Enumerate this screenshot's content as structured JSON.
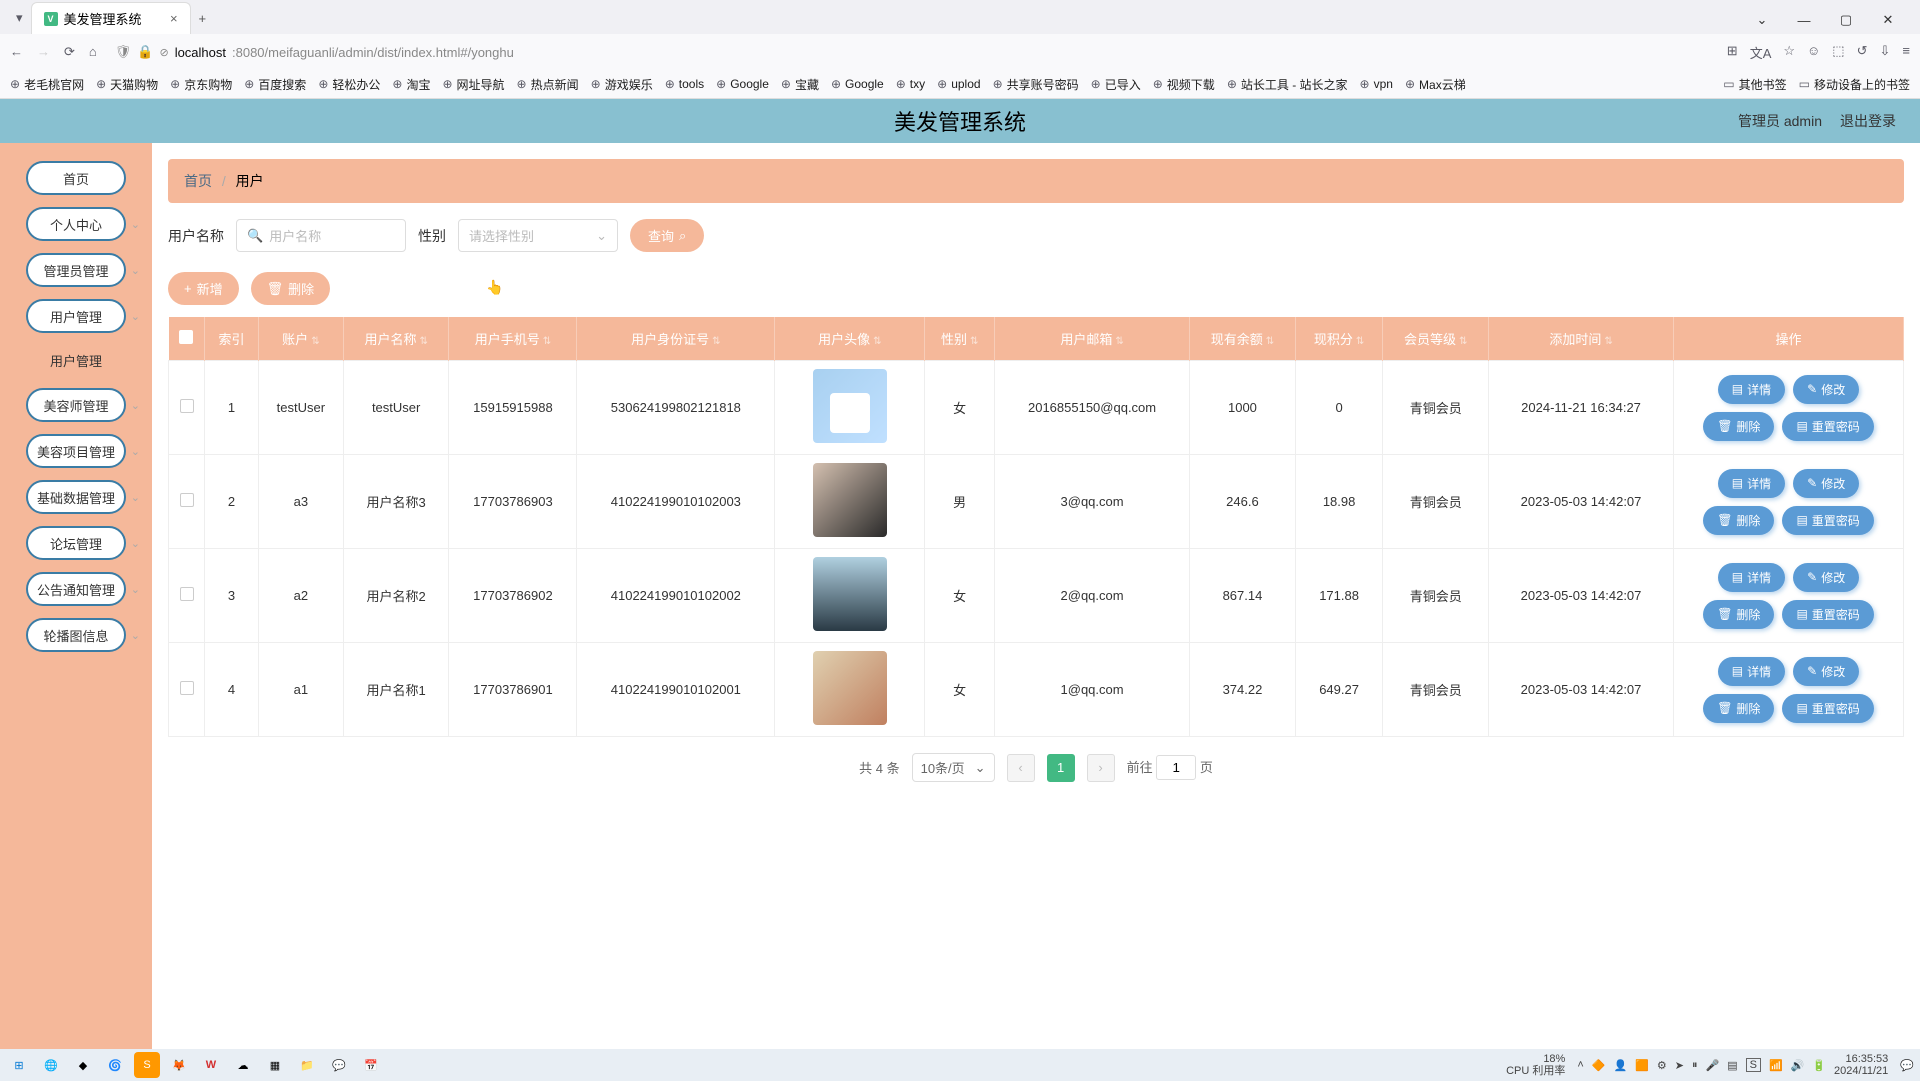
{
  "browser": {
    "tab_title": "美发管理系统",
    "url_prefix": "localhost",
    "url_port_path": ":8080/meifaguanli/admin/dist/index.html#/yonghu",
    "bookmarks": [
      "老毛桃官网",
      "天猫购物",
      "京东购物",
      "百度搜索",
      "轻松办公",
      "淘宝",
      "网址导航",
      "热点新闻",
      "游戏娱乐",
      "tools",
      "Google",
      "宝藏",
      "Google",
      "txy",
      "uplod",
      "共享账号密码",
      "已导入",
      "视频下载",
      "站长工具 - 站长之家",
      "vpn",
      "Max云梯"
    ],
    "bookmarks_right": [
      "其他书签",
      "移动设备上的书签"
    ]
  },
  "header": {
    "title": "美发管理系统",
    "admin_label": "管理员 admin",
    "logout": "退出登录"
  },
  "sidebar": {
    "items": [
      "首页",
      "个人中心",
      "管理员管理",
      "用户管理",
      "美容师管理",
      "美容项目管理",
      "基础数据管理",
      "论坛管理",
      "公告通知管理",
      "轮播图信息"
    ],
    "submenu": "用户管理"
  },
  "breadcrumb": {
    "home": "首页",
    "current": "用户"
  },
  "filters": {
    "name_label": "用户名称",
    "name_placeholder": "用户名称",
    "gender_label": "性别",
    "gender_placeholder": "请选择性别",
    "search": "查询"
  },
  "actions": {
    "add": "新增",
    "delete": "删除"
  },
  "table": {
    "headers": [
      "",
      "索引",
      "账户",
      "用户名称",
      "用户手机号",
      "用户身份证号",
      "用户头像",
      "性别",
      "用户邮箱",
      "现有余额",
      "现积分",
      "会员等级",
      "添加时间",
      "操作"
    ],
    "row_actions": {
      "detail": "详情",
      "edit": "修改",
      "delete": "删除",
      "reset_pwd": "重置密码"
    },
    "rows": [
      {
        "idx": "1",
        "account": "testUser",
        "name": "testUser",
        "phone": "15915915988",
        "idcard": "530624199802121818",
        "gender": "女",
        "email": "2016855150@qq.com",
        "balance": "1000",
        "points": "0",
        "level": "青铜会员",
        "created": "2024-11-21 16:34:27",
        "av": "av1"
      },
      {
        "idx": "2",
        "account": "a3",
        "name": "用户名称3",
        "phone": "17703786903",
        "idcard": "410224199010102003",
        "gender": "男",
        "email": "3@qq.com",
        "balance": "246.6",
        "points": "18.98",
        "level": "青铜会员",
        "created": "2023-05-03 14:42:07",
        "av": "av2"
      },
      {
        "idx": "3",
        "account": "a2",
        "name": "用户名称2",
        "phone": "17703786902",
        "idcard": "410224199010102002",
        "gender": "女",
        "email": "2@qq.com",
        "balance": "867.14",
        "points": "171.88",
        "level": "青铜会员",
        "created": "2023-05-03 14:42:07",
        "av": "av3"
      },
      {
        "idx": "4",
        "account": "a1",
        "name": "用户名称1",
        "phone": "17703786901",
        "idcard": "410224199010102001",
        "gender": "女",
        "email": "1@qq.com",
        "balance": "374.22",
        "points": "649.27",
        "level": "青铜会员",
        "created": "2023-05-03 14:42:07",
        "av": "av4"
      }
    ]
  },
  "pagination": {
    "total": "共 4 条",
    "per_page": "10条/页",
    "current": "1",
    "jump_prefix": "前往",
    "jump_value": "1",
    "jump_suffix": "页"
  },
  "system": {
    "cpu_pct": "18%",
    "cpu_label": "CPU 利用率",
    "time": "16:35:53",
    "date": "2024/11/21"
  }
}
